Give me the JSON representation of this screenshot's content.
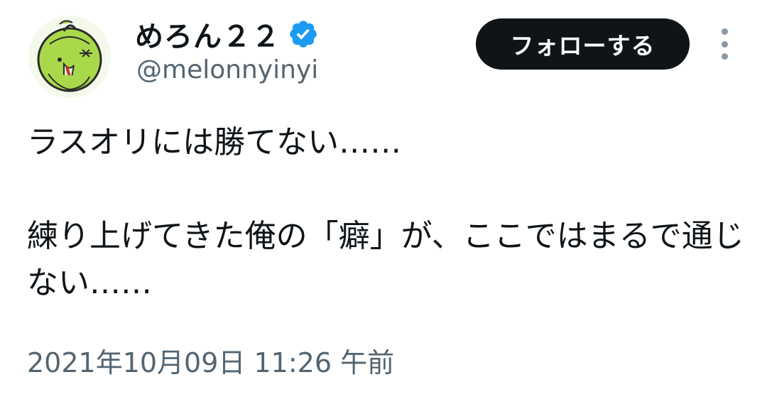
{
  "author": {
    "display_name": "めろん２２",
    "handle": "@melonnyinyi",
    "verified_icon": "verified-badge-icon",
    "avatar_icon": "melon-character-avatar",
    "verified_color": "#1d9bf0"
  },
  "actions": {
    "follow_label": "フォローする",
    "more_icon": "more-vertical-icon"
  },
  "tweet": {
    "text": "ラスオリには勝てない……\n\n練り上げてきた俺の「癖」が、ここではまるで通じない……",
    "timestamp": "2021年10月09日 11:26 午前"
  },
  "colors": {
    "text_primary": "#0f1419",
    "text_secondary": "#536471",
    "follow_bg": "#0f1419",
    "follow_text": "#ffffff"
  }
}
